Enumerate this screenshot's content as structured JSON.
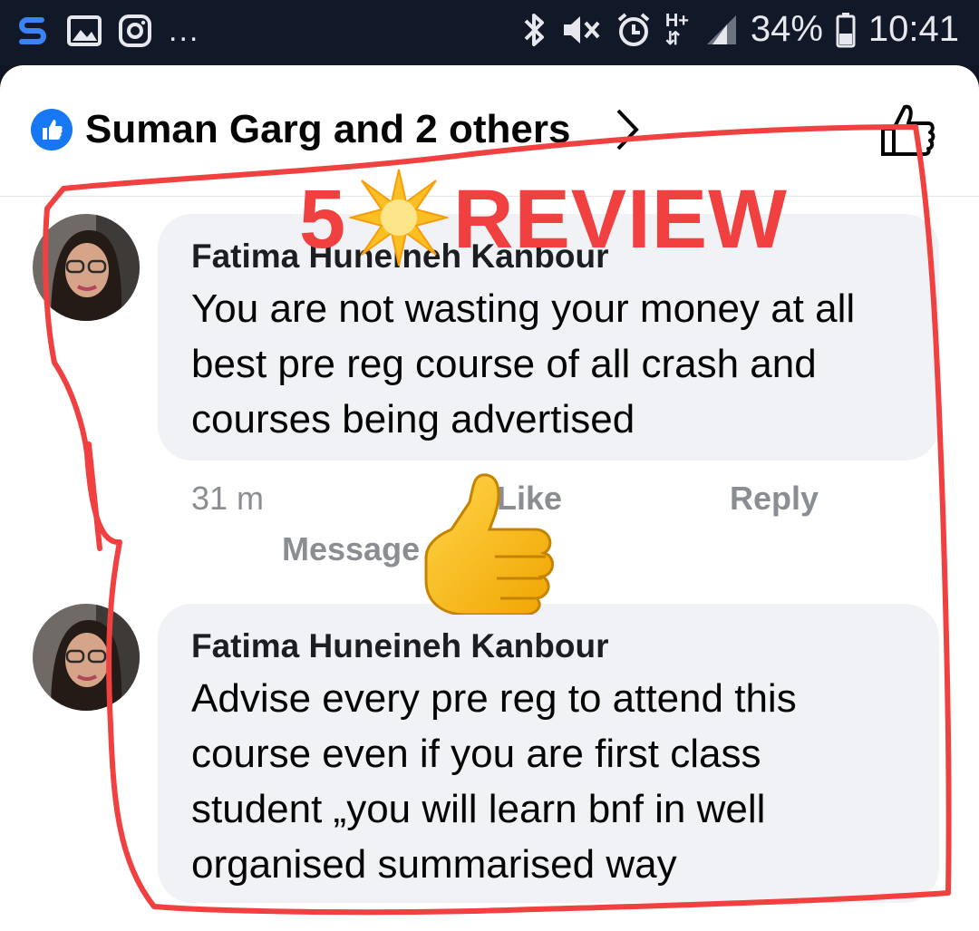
{
  "status_bar": {
    "more": "...",
    "battery": "34%",
    "network": "H+",
    "time": "10:41",
    "icons": [
      "s-app-icon",
      "gallery-icon",
      "instagram-icon",
      "bluetooth-icon",
      "mute-icon",
      "alarm-icon",
      "data-icon",
      "signal-icon",
      "battery-icon"
    ]
  },
  "reactions": {
    "text": "Suman Garg and 2 others",
    "badge_color": "#1877f2"
  },
  "overlay": {
    "digit": "5",
    "word": "REVIEW",
    "color": "#f04040"
  },
  "comments": [
    {
      "author": "Fatima Huneineh Kanbour",
      "lines": [
        "You are not wasting your money at all",
        "best pre reg course of all crash and",
        "courses being advertised"
      ],
      "time": "31 m",
      "like_label": "Like",
      "reply_label": "Reply",
      "message_label": "Message"
    },
    {
      "author": "Fatima Huneineh Kanbour",
      "lines": [
        "Advise every pre reg to attend this",
        "course even if you are first class",
        "student „you will learn bnf in well",
        "organised summarised way"
      ]
    }
  ],
  "colors": {
    "text_primary": "#050505",
    "meta": "#8a8d91",
    "bubble": "#f0f2f5",
    "annotation": "#f04040"
  }
}
